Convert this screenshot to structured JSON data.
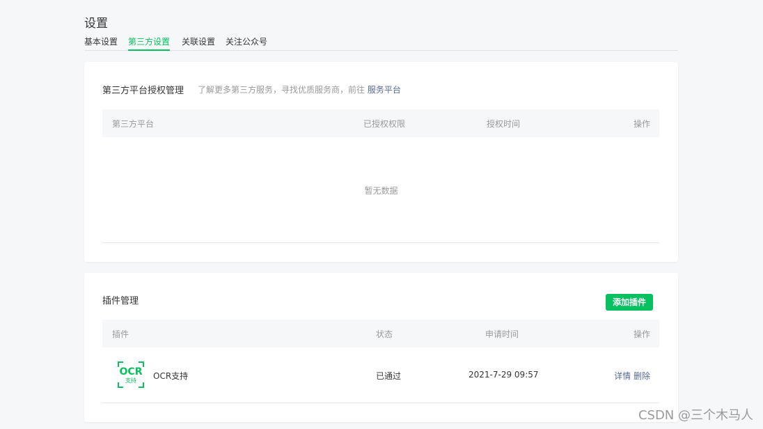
{
  "page": {
    "title": "设置"
  },
  "tabs": [
    {
      "label": "基本设置",
      "active": false
    },
    {
      "label": "第三方设置",
      "active": true
    },
    {
      "label": "关联设置",
      "active": false
    },
    {
      "label": "关注公众号",
      "active": false
    }
  ],
  "third_party": {
    "title": "第三方平台授权管理",
    "desc": "了解更多第三方服务，寻找优质服务商，前往 ",
    "link": "服务平台",
    "columns": [
      "第三方平台",
      "已授权权限",
      "授权时间",
      "操作"
    ],
    "empty_text": "暂无数据"
  },
  "plugins": {
    "title": "插件管理",
    "add_button": "添加插件",
    "columns": [
      "插件",
      "状态",
      "申请时间",
      "操作"
    ],
    "rows": [
      {
        "icon": "ocr-logo",
        "logo_text": "OCR",
        "logo_sub": "支持",
        "name": "OCR支持",
        "status": "已通过",
        "time": "2021-7-29 09:57",
        "actions": [
          "详情",
          "删除"
        ]
      }
    ]
  },
  "watermark": "CSDN @三个木马人",
  "colors": {
    "accent": "#07c160",
    "link": "#576b95",
    "muted": "#9a9a9a",
    "background": "#f6f7f9"
  }
}
